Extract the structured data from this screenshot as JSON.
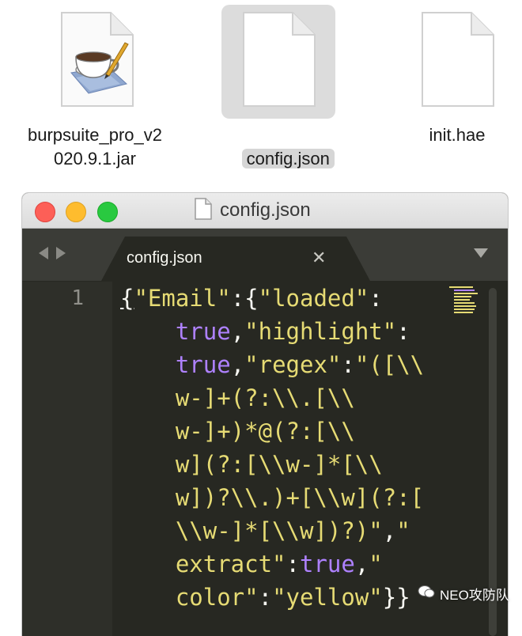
{
  "files": [
    {
      "name": "burpsuite_pro_v2\n020.9.1.jar",
      "icon": "java-jar-icon",
      "selected": false
    },
    {
      "name": "config.json",
      "icon": "blank-document-icon",
      "selected": true
    },
    {
      "name": "init.hae",
      "icon": "blank-document-icon",
      "selected": false
    }
  ],
  "window": {
    "title": "config.json",
    "tab_label": "config.json",
    "close_glyph": "✕",
    "line_number": "1"
  },
  "code": {
    "lines": [
      [
        {
          "t": "{",
          "c": "p",
          "cursor": true
        },
        {
          "t": "\"Email\"",
          "c": "k"
        },
        {
          "t": ":",
          "c": "p"
        },
        {
          "t": "{",
          "c": "p"
        },
        {
          "t": "\"loaded\"",
          "c": "k"
        },
        {
          "t": ":",
          "c": "p"
        }
      ],
      [
        {
          "t": "    ",
          "c": "p"
        },
        {
          "t": "true",
          "c": "b"
        },
        {
          "t": ",",
          "c": "p"
        },
        {
          "t": "\"highlight\"",
          "c": "k"
        },
        {
          "t": ":",
          "c": "p"
        }
      ],
      [
        {
          "t": "    ",
          "c": "p"
        },
        {
          "t": "true",
          "c": "b"
        },
        {
          "t": ",",
          "c": "p"
        },
        {
          "t": "\"regex\"",
          "c": "k"
        },
        {
          "t": ":",
          "c": "p"
        },
        {
          "t": "\"([\\\\",
          "c": "k"
        }
      ],
      [
        {
          "t": "    w-]+(?:\\\\.[\\\\",
          "c": "k"
        }
      ],
      [
        {
          "t": "    w-]+)*@(?:[\\\\",
          "c": "k"
        }
      ],
      [
        {
          "t": "    w](?:[\\\\w-]*[\\\\",
          "c": "k"
        }
      ],
      [
        {
          "t": "    w])?\\\\.)+[\\\\w](?:[",
          "c": "k"
        }
      ],
      [
        {
          "t": "    \\\\w-]*[\\\\w])?)\"",
          "c": "k"
        },
        {
          "t": ",",
          "c": "p"
        },
        {
          "t": "\"",
          "c": "k"
        }
      ],
      [
        {
          "t": "    extract\"",
          "c": "k"
        },
        {
          "t": ":",
          "c": "p"
        },
        {
          "t": "true",
          "c": "b"
        },
        {
          "t": ",",
          "c": "p"
        },
        {
          "t": "\"",
          "c": "k"
        }
      ],
      [
        {
          "t": "    color\"",
          "c": "k"
        },
        {
          "t": ":",
          "c": "p"
        },
        {
          "t": "\"yellow\"",
          "c": "k"
        },
        {
          "t": "}}",
          "c": "p"
        }
      ]
    ]
  },
  "watermark": "NEO攻防队",
  "colors": {
    "editor_bg": "#272822",
    "string": "#e6db74",
    "boolean": "#ae81ff",
    "punctuation": "#f8f8f2"
  }
}
